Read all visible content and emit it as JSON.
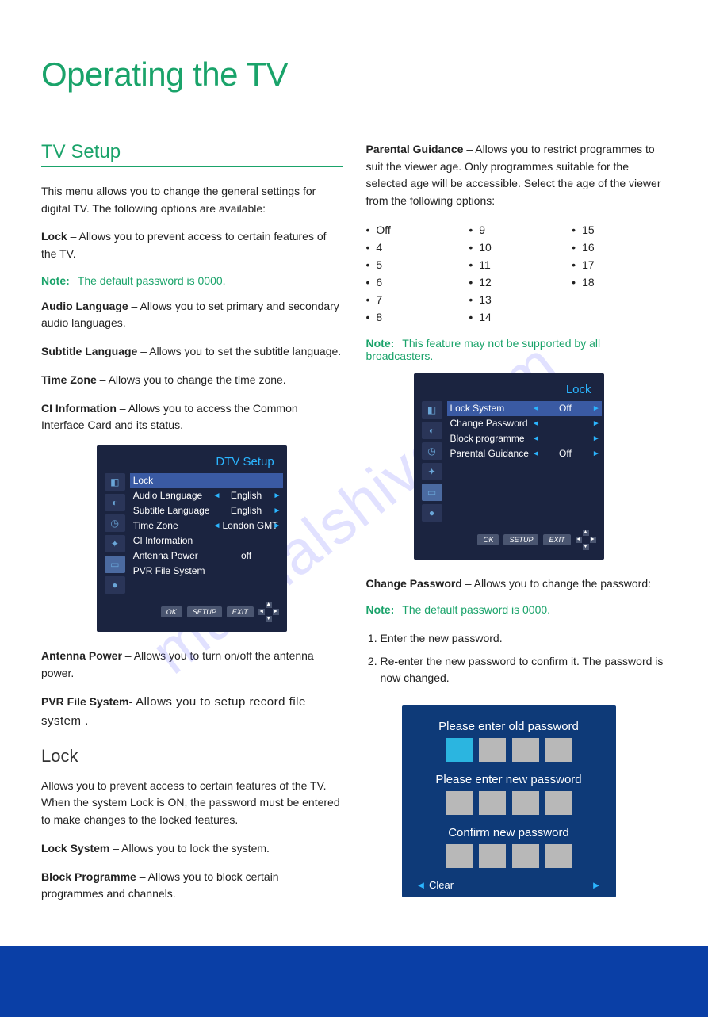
{
  "title": "Operating the TV",
  "watermark": "manualshive.com",
  "left": {
    "section": "TV Setup",
    "intro": "This menu allows you to change the general settings for digital TV. The following options are available:",
    "defs": [
      {
        "label": "Lock",
        "sep": " – ",
        "text": "Allows you to prevent access to certain features of the TV."
      }
    ],
    "note1_label": "Note:",
    "note1_text": "The default password is 0000.",
    "defs2": [
      {
        "label": "Audio Language",
        "sep": " – ",
        "text": "Allows you to set primary and secondary audio languages."
      },
      {
        "label": "Subtitle Language",
        "sep": " – ",
        "text": "Allows you to set the subtitle language."
      },
      {
        "label": "Time Zone",
        "sep": " – ",
        "text": "Allows you to change the time zone."
      },
      {
        "label": "CI Information",
        "sep": " – ",
        "text": "Allows you to access the Common Interface Card and its status."
      }
    ],
    "osd_dtv": {
      "title": "DTV Setup",
      "rows": [
        {
          "name": "Lock",
          "val": "",
          "hl": true
        },
        {
          "name": "Audio Language",
          "val": "English"
        },
        {
          "name": "Subtitle Language",
          "val": "English"
        },
        {
          "name": "Time Zone",
          "val": "London GMT"
        },
        {
          "name": "CI Information",
          "val": ""
        },
        {
          "name": "Antenna Power",
          "val": "off"
        },
        {
          "name": "PVR File System",
          "val": ""
        }
      ],
      "nav": [
        "OK",
        "SETUP",
        "EXIT"
      ]
    },
    "defs3": [
      {
        "label": "Antenna Power",
        "sep": " – ",
        "text": "Allows you to turn on/off the antenna power."
      },
      {
        "label": "PVR File System",
        "sep": "- ",
        "text": "Allows you to setup record file system ."
      }
    ],
    "sub_lock": "Lock",
    "lock_intro": "Allows you to prevent access to certain features of the TV. When the system Lock is ON, the password must be entered to make changes to the locked features.",
    "defs4": [
      {
        "label": "Lock System",
        "sep": " – ",
        "text": "Allows you to lock the system."
      },
      {
        "label": "Block Programme",
        "sep": " – ",
        "text": "Allows you to block certain programmes and channels."
      }
    ]
  },
  "right": {
    "pg_def": {
      "label": "Parental Guidance",
      "sep": " – ",
      "text": "Allows you to restrict programmes to suit the viewer age. Only programmes suitable for the selected age will be accessible. Select the age of the viewer from the following options:"
    },
    "pg_cols": [
      [
        "Off",
        "4",
        "5",
        "6",
        "7",
        "8"
      ],
      [
        "9",
        "10",
        "11",
        "12",
        "13",
        "14"
      ],
      [
        "15",
        "16",
        "17",
        "18"
      ]
    ],
    "note_pg_label": "Note:",
    "note_pg_text": "This feature may not be supported by all broadcasters.",
    "osd_lock": {
      "title": "Lock",
      "rows": [
        {
          "name": "Lock System",
          "val": "Off",
          "hl": true
        },
        {
          "name": "Change Password",
          "val": ""
        },
        {
          "name": "Block programme",
          "val": ""
        },
        {
          "name": "Parental Guidance",
          "val": "Off"
        }
      ],
      "nav": [
        "OK",
        "SETUP",
        "EXIT"
      ]
    },
    "cp_def": {
      "label": "Change Password",
      "sep": " – ",
      "text": "Allows you to change the password:"
    },
    "note_cp_label": "Note:",
    "note_cp_text": "The default password is 0000.",
    "steps": [
      "Enter the new password.",
      "Re-enter the new password to confirm it. The password is now changed."
    ],
    "osd_pwd": {
      "l1": "Please enter old password",
      "l2": "Please enter new password",
      "l3": "Confirm new password",
      "clear": "Clear",
      "arrow": "►"
    }
  }
}
